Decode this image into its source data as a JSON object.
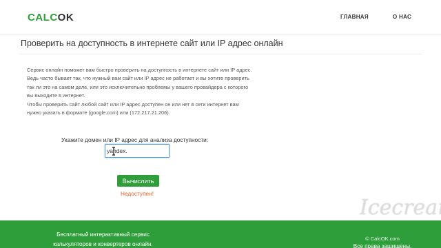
{
  "header": {
    "logo_calc": "CALC",
    "logo_ok": "OK",
    "nav": {
      "home": "ГЛАВНАЯ",
      "about": "О НАС"
    }
  },
  "main": {
    "title": "Проверить на доступность в интернете сайт или IP адрес онлайн",
    "description": [
      "Сервис онлайн поможет вам быстро проверить на доступность в интернете сайт или IP адрес.",
      "Ведь часто бывает так, что нужный вам сайт или IP адрес не работает и вы хотите проверить так ли это на самом деле, или это исключительно проблемы у вашего провайдера с которого вы выходите в интернет.",
      "Чтобы проверить сайт любой сайт или IP адрес доступен он или нет в сети интернет вам нужно указать в формате (google.com) или (172.217.21.206)."
    ],
    "input_label": "Укажите домен или IP адрес для анализа доступности:",
    "input_value": "yandex.",
    "button_label": "Вычислить",
    "result": "Недоступен!"
  },
  "footer": {
    "left_text": "Бесплатный интерактивный сервис калькуляторов и конвертеров онлайн.",
    "copyright": "© CalcOK.com",
    "rights": "Все права защищены."
  },
  "watermark": "Icecream",
  "colors": {
    "brand_green": "#2e9e3a",
    "result_orange": "#e0612a",
    "input_focus": "#5b9dd9"
  }
}
